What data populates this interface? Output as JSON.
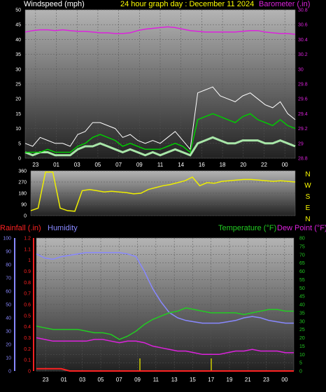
{
  "colors": {
    "windspeed": "#ffffff",
    "gust": "#ffffff",
    "average": "#00cc00",
    "gust_fill": "#a8e6a8",
    "barometer": "#dd22dd",
    "direction": "#eeee00",
    "rainfall": "#ff2222",
    "humidity": "#8888ff",
    "temperature": "#22cc22",
    "dew_point": "#dd22dd",
    "title": "#ffff00"
  },
  "header": {
    "windspeed_label": "Windspeed (mph)",
    "title": "24 hour graph day : December 11 2024",
    "barometer_label": "Barometer (.in)"
  },
  "lower_header": {
    "rainfall_label": "Rainfall (.in)",
    "humidity_label": "Humidity",
    "temperature_label": "Temperature (°F)",
    "dew_point_label": "Dew Point (°F)"
  },
  "chart_data": [
    {
      "type": "line",
      "name": "wind",
      "x_ticks": [
        "23",
        "01",
        "03",
        "05",
        "07",
        "09",
        "11",
        "14",
        "16",
        "18",
        "20",
        "22",
        "00"
      ],
      "left_axis": {
        "label": "Windspeed (mph)",
        "ylim": [
          0,
          50
        ],
        "ticks": [
          "0",
          "5",
          "10",
          "15",
          "20",
          "25",
          "30",
          "35",
          "40",
          "45",
          "50"
        ]
      },
      "right_axis": {
        "label": "Barometer (.in)",
        "ylim": [
          28.8,
          30.8
        ],
        "ticks": [
          "28.8",
          "29",
          "29.2",
          "29.4",
          "29.6",
          "29.8",
          "30",
          "30.2",
          "30.4",
          "30.6",
          "30.8"
        ]
      },
      "series": {
        "gust": [
          5,
          4,
          7,
          6,
          5,
          5,
          4,
          8,
          9,
          12,
          12,
          11,
          10,
          7,
          8,
          6,
          5,
          6,
          5,
          7,
          9,
          6,
          3,
          22,
          23,
          24,
          21,
          20,
          19,
          21,
          22,
          20,
          18,
          17,
          19,
          15,
          13
        ],
        "average": [
          2,
          2,
          2,
          3,
          2,
          2,
          2,
          4,
          5,
          7,
          8,
          7,
          6,
          4,
          5,
          4,
          3,
          3,
          3,
          4,
          5,
          4,
          2,
          13,
          14,
          15,
          14,
          13,
          12,
          14,
          15,
          13,
          12,
          11,
          13,
          11,
          10
        ],
        "gust_band_high": [
          2,
          1,
          2,
          2,
          1,
          1,
          1,
          3,
          4,
          4,
          5,
          4,
          3,
          2,
          3,
          2,
          1,
          2,
          1,
          2,
          3,
          2,
          1,
          5,
          6,
          7,
          6,
          5,
          5,
          6,
          6,
          6,
          5,
          5,
          6,
          5,
          4
        ],
        "barometer": [
          30.5,
          30.52,
          30.53,
          30.53,
          30.52,
          30.53,
          30.52,
          30.51,
          30.51,
          30.5,
          30.49,
          30.49,
          30.48,
          30.48,
          30.49,
          30.52,
          30.54,
          30.55,
          30.56,
          30.57,
          30.56,
          30.54,
          30.52,
          30.51,
          30.5,
          30.5,
          30.5,
          30.5,
          30.5,
          30.51,
          30.52,
          30.52,
          30.5,
          30.49,
          30.48,
          30.48,
          30.47
        ]
      }
    },
    {
      "type": "line",
      "name": "wind_direction",
      "x_ticks": [
        "23",
        "01",
        "03",
        "05",
        "07",
        "09",
        "11",
        "14",
        "16",
        "18",
        "20",
        "22",
        "00"
      ],
      "left_axis": {
        "ylim": [
          0,
          360
        ],
        "ticks": [
          "0",
          "90",
          "180",
          "270",
          "360"
        ]
      },
      "right_labels": [
        "N",
        "W",
        "S",
        "E",
        "N"
      ],
      "series": {
        "direction": [
          40,
          60,
          350,
          350,
          60,
          40,
          35,
          200,
          210,
          200,
          190,
          195,
          190,
          185,
          175,
          180,
          210,
          225,
          240,
          250,
          265,
          280,
          310,
          240,
          265,
          260,
          275,
          280,
          285,
          290,
          290,
          285,
          280,
          275,
          280,
          275,
          270
        ]
      }
    },
    {
      "type": "line",
      "name": "temperature_humidity",
      "x_ticks": [
        "23",
        "01",
        "03",
        "05",
        "07",
        "09",
        "11",
        "13",
        "15",
        "17",
        "19",
        "21",
        "23",
        "00"
      ],
      "rainfall_axis": {
        "label": "Rainfall (.in)",
        "ylim": [
          0,
          1.2
        ],
        "ticks": [
          "0",
          "0.1",
          "0.2",
          "0.3",
          "0.4",
          "0.5",
          "0.6",
          "0.7",
          "0.8",
          "0.9",
          "1",
          "1.1",
          "1.2"
        ]
      },
      "humidity_axis": {
        "label": "Humidity",
        "ylim": [
          0,
          100
        ],
        "ticks": [
          "0",
          "10",
          "20",
          "30",
          "40",
          "50",
          "60",
          "70",
          "80",
          "90",
          "100"
        ]
      },
      "temperature_axis": {
        "label": "Temperature (°F)",
        "ylim": [
          0,
          80
        ],
        "ticks": [
          "0",
          "5",
          "10",
          "15",
          "20",
          "25",
          "30",
          "35",
          "40",
          "45",
          "50",
          "55",
          "60",
          "65",
          "70",
          "75",
          "80"
        ]
      },
      "series": {
        "humidity": [
          88,
          85,
          84,
          86,
          87,
          88,
          89,
          89,
          89,
          89,
          89,
          88,
          86,
          75,
          62,
          52,
          44,
          40,
          38,
          37,
          36,
          36,
          36,
          37,
          38,
          40,
          41,
          40,
          38,
          37,
          36,
          36
        ],
        "temperature": [
          27,
          26,
          25,
          25,
          25,
          25,
          24,
          23,
          23,
          22,
          19,
          21,
          24,
          28,
          31,
          33,
          35,
          36,
          38,
          37,
          36,
          35,
          35,
          35,
          35,
          34,
          35,
          36,
          37,
          37,
          36,
          36
        ],
        "dew_point": [
          20,
          19,
          18,
          18,
          18,
          18,
          18,
          19,
          19,
          18,
          17,
          18,
          18,
          17,
          15,
          14,
          13,
          12,
          12,
          11,
          10,
          10,
          10,
          11,
          12,
          12,
          13,
          12,
          12,
          12,
          11,
          11
        ],
        "rainfall": [
          0.02,
          0.02,
          0.02,
          0.02,
          0.0,
          0.0,
          0.0,
          0.0,
          0.0,
          0.0,
          0.0,
          0.0,
          0.0,
          0.0,
          0.0,
          0.0,
          0.0,
          0.0,
          0.0,
          0.0,
          0.0,
          0.0,
          0.0,
          0.0,
          0.0,
          0.0,
          0.0,
          0.0,
          0.0,
          0.0,
          0.0,
          0.0
        ]
      }
    }
  ]
}
